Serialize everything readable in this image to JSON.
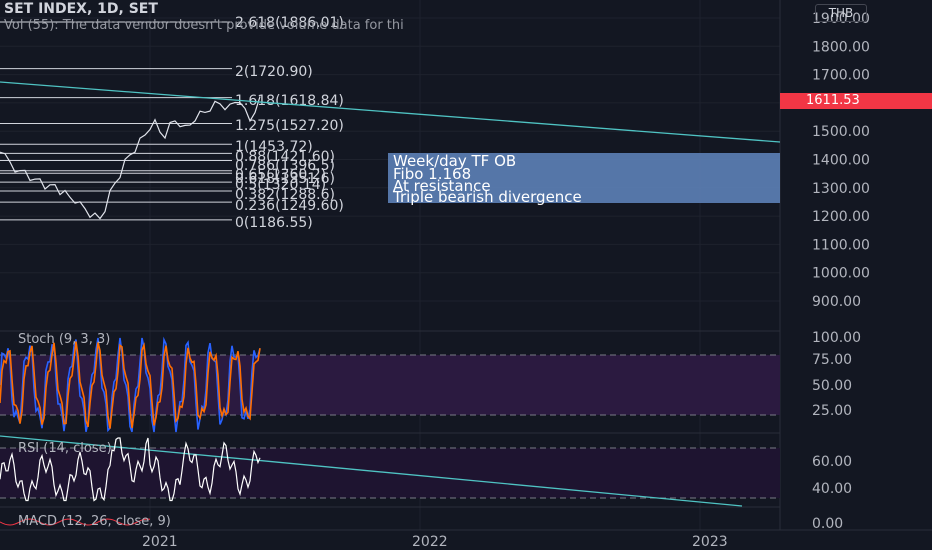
{
  "header": {
    "symbol_line": "SET INDEX, 1D, SET",
    "volume_note": "Vol (55): The data vendor doesn't provide volume data for thi",
    "currency": "THB"
  },
  "price_badge": {
    "value": "1611.53",
    "color": "#f23645"
  },
  "annotation": {
    "lines": [
      "Week/day TF OB",
      "Fibo 1.168",
      "At resistance",
      "Triple bearish divergence"
    ],
    "bg": "#5b7fb4"
  },
  "fib_labels": [
    {
      "label": "2.618(1886.01)",
      "value": 1886.01
    },
    {
      "label": "2(1720.90)",
      "value": 1720.9
    },
    {
      "label": "1.618(1618.84)",
      "value": 1618.84
    },
    {
      "label": "1.275(1527.20)",
      "value": 1527.2
    },
    {
      "label": "1(1453.72)",
      "value": 1453.72
    },
    {
      "label": "0.88(1421.60)",
      "value": 1421.6
    },
    {
      "label": "0.786(1396.5)",
      "value": 1396.5
    },
    {
      "label": "0.65(1360.2)",
      "value": 1360.2
    },
    {
      "label": "0.618(1351.6)",
      "value": 1351.6
    },
    {
      "label": "0.5(1320.14)",
      "value": 1320.14
    },
    {
      "label": "0.382(1288.6)",
      "value": 1288.6
    },
    {
      "label": "0.236(1249.60)",
      "value": 1249.6
    },
    {
      "label": "0(1186.55)",
      "value": 1186.55
    }
  ],
  "panes": {
    "stoch": {
      "title": "Stoch (9, 3, 3)"
    },
    "rsi": {
      "title": "RSI (14, close)"
    },
    "macd": {
      "title": "MACD (12, 26, close, 9)"
    }
  },
  "chart_data": {
    "type": "line",
    "title": "SET INDEX, 1D, SET",
    "price_axis": {
      "ticks": [
        "1900.00",
        "1800.00",
        "1700.00",
        "1600.00",
        "1500.00",
        "1400.00",
        "1300.00",
        "1200.00",
        "1100.00",
        "1000.00",
        "900.00"
      ],
      "tick_values": [
        1900,
        1800,
        1700,
        1600,
        1500,
        1400,
        1300,
        1200,
        1100,
        1000,
        900
      ],
      "ylim": [
        850,
        1920
      ]
    },
    "stoch_axis": {
      "ticks": [
        "100.00",
        "75.00",
        "50.00",
        "25.00"
      ],
      "tick_values": [
        100,
        75,
        50,
        25
      ],
      "bands": [
        80,
        20
      ]
    },
    "rsi_axis": {
      "ticks": [
        "60.00",
        "40.00"
      ],
      "tick_values": [
        60,
        40
      ],
      "bands": [
        70,
        30
      ]
    },
    "macd_axis": {
      "ticks": [
        "0.00"
      ],
      "tick_values": [
        0
      ]
    },
    "time_axis": {
      "ticks": [
        "2021",
        "2022",
        "2023"
      ]
    },
    "price_series": {
      "name": "SET INDEX",
      "values": [
        1440,
        1410,
        1395,
        1370,
        1350,
        1365,
        1340,
        1320,
        1335,
        1310,
        1300,
        1315,
        1290,
        1280,
        1270,
        1260,
        1240,
        1230,
        1210,
        1200,
        1195,
        1230,
        1280,
        1320,
        1350,
        1390,
        1420,
        1440,
        1465,
        1490,
        1520,
        1530,
        1500,
        1490,
        1520,
        1540,
        1530,
        1510,
        1525,
        1550,
        1560,
        1570,
        1585,
        1595,
        1600,
        1590,
        1585,
        1605,
        1615,
        1570,
        1540,
        1580,
        1612
      ],
      "color": "#e0e3eb"
    },
    "trendlines": [
      {
        "name": "price-resistance",
        "from": [
          0,
          1648
        ],
        "to": [
          1,
          1470
        ],
        "color": "#4fc3c3"
      }
    ],
    "stoch_series": [
      {
        "name": "%K",
        "color": "#2962ff"
      },
      {
        "name": "%D",
        "color": "#ff6d00"
      }
    ],
    "rsi_series": {
      "name": "RSI",
      "color": "#ffffff"
    }
  }
}
